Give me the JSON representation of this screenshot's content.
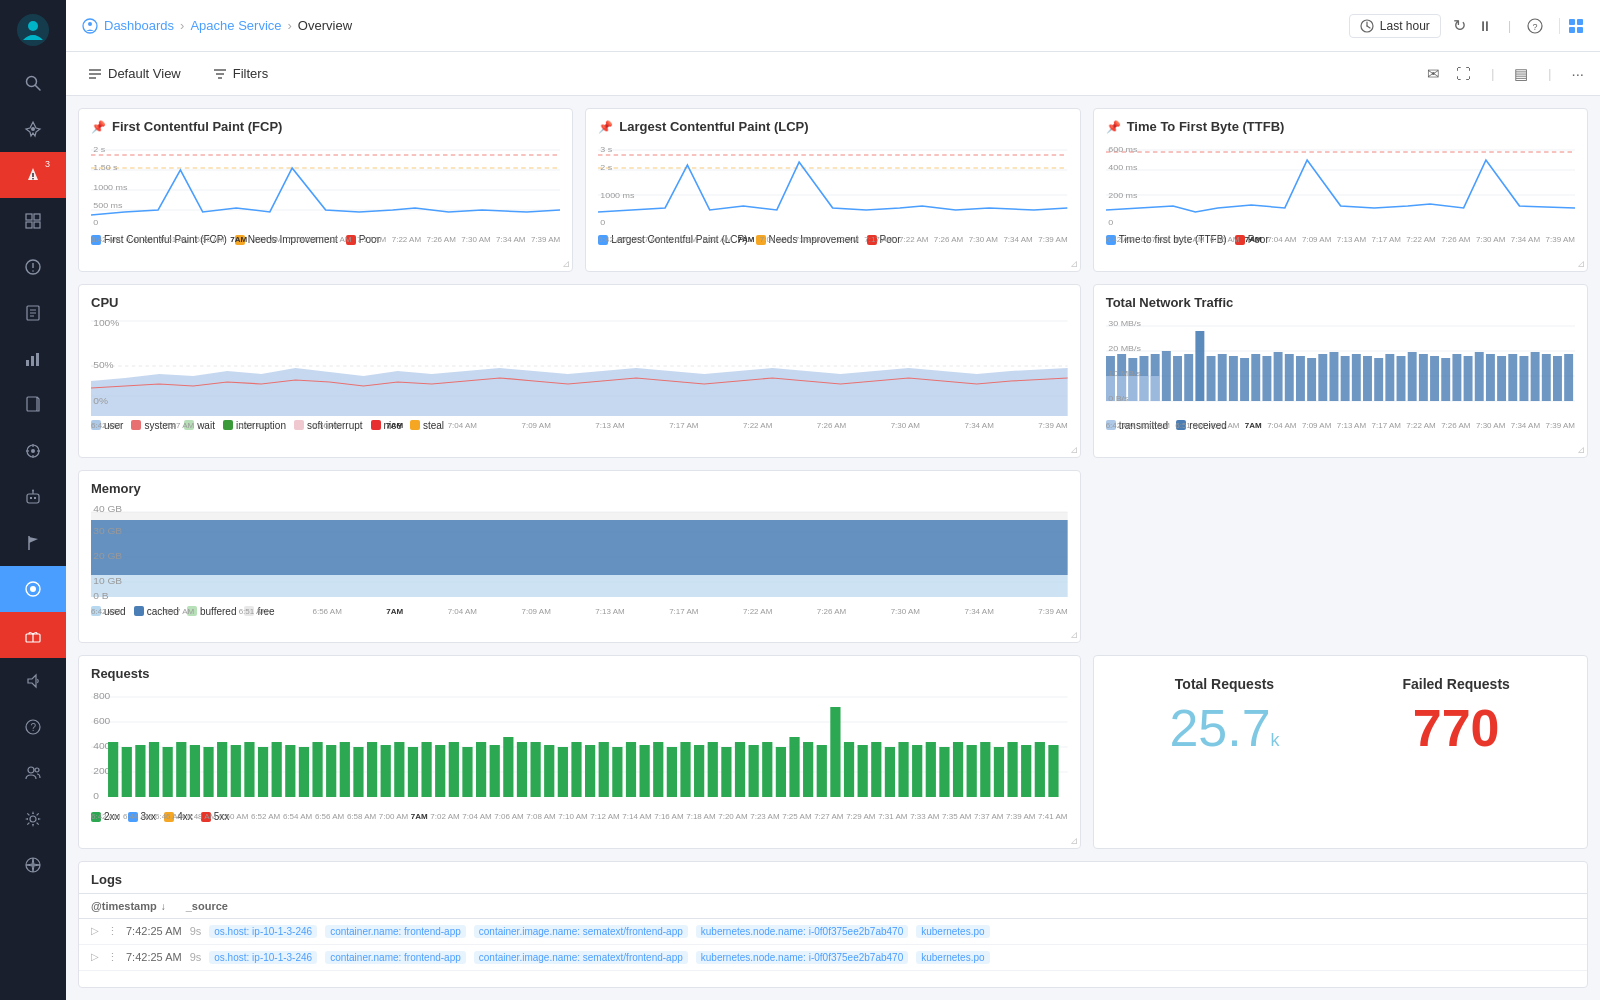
{
  "sidebar": {
    "items": [
      {
        "name": "logo",
        "icon": "🐙"
      },
      {
        "name": "search",
        "icon": "🔍"
      },
      {
        "name": "rocket",
        "icon": "🚀"
      },
      {
        "name": "alerts",
        "icon": "🔔",
        "badge": "3"
      },
      {
        "name": "grid",
        "icon": "⊞"
      },
      {
        "name": "warning",
        "icon": "⚠"
      },
      {
        "name": "reports",
        "icon": "📊"
      },
      {
        "name": "bar-chart",
        "icon": "📈"
      },
      {
        "name": "docs",
        "icon": "📄"
      },
      {
        "name": "crosshair",
        "icon": "⊕"
      },
      {
        "name": "robot",
        "icon": "🤖"
      },
      {
        "name": "flag",
        "icon": "⚑"
      },
      {
        "name": "active-icon",
        "icon": "◉"
      },
      {
        "name": "gift",
        "icon": "🎁"
      },
      {
        "name": "speaker",
        "icon": "📣"
      },
      {
        "name": "help",
        "icon": "?"
      },
      {
        "name": "users",
        "icon": "👥"
      },
      {
        "name": "settings",
        "icon": "⚙"
      },
      {
        "name": "globe",
        "icon": "🌐"
      }
    ]
  },
  "topnav": {
    "breadcrumb": {
      "dashboards": "Dashboards",
      "service": "Apache Service",
      "current": "Overview"
    },
    "time_label": "Last hour",
    "refresh_icon": "↻",
    "pause_icon": "⏸",
    "help_icon": "?"
  },
  "toolbar": {
    "default_view_label": "Default View",
    "filters_label": "Filters",
    "email_icon": "✉",
    "fullscreen_icon": "⛶",
    "columns_icon": "▤",
    "more_icon": "···"
  },
  "panels": {
    "fcp": {
      "title": "First Contentful Paint (FCP)",
      "legend": [
        {
          "label": "First Contentful Paint (FCP)",
          "color": "#4a9eff"
        },
        {
          "label": "Needs Improvement",
          "color": "#f5a623"
        },
        {
          "label": "Poor",
          "color": "#e8362a"
        }
      ],
      "y_labels": [
        "2 s",
        "1.50 s",
        "1000 ms",
        "500 ms",
        "0"
      ]
    },
    "lcp": {
      "title": "Largest Contentful Paint (LCP)",
      "legend": [
        {
          "label": "Largest Contentful Paint (LCP)",
          "color": "#4a9eff"
        },
        {
          "label": "Needs Improvement",
          "color": "#f5a623"
        },
        {
          "label": "Poor",
          "color": "#e8362a"
        }
      ],
      "y_labels": [
        "3 s",
        "2 s",
        "1000 ms",
        "0"
      ]
    },
    "ttfb": {
      "title": "Time To First Byte (TTFB)",
      "legend": [
        {
          "label": "Time to first byte (TTFB)",
          "color": "#4a9eff"
        },
        {
          "label": "Poor",
          "color": "#e8362a"
        }
      ],
      "y_labels": [
        "600 ms",
        "400 ms",
        "200 ms",
        "0"
      ]
    },
    "cpu": {
      "title": "CPU",
      "legend": [
        {
          "label": "user",
          "color": "#aec8e8"
        },
        {
          "label": "system",
          "color": "#e87070"
        },
        {
          "label": "wait",
          "color": "#b8e0b8"
        },
        {
          "label": "interruption",
          "color": "#3a9a3a"
        },
        {
          "label": "soft interrupt",
          "color": "#f0c8d0"
        },
        {
          "label": "nice",
          "color": "#e83030"
        },
        {
          "label": "steal",
          "color": "#f5a623"
        }
      ],
      "y_labels": [
        "100%",
        "50%",
        "0%"
      ]
    },
    "memory": {
      "title": "Memory",
      "legend": [
        {
          "label": "used",
          "color": "#b8d8f0"
        },
        {
          "label": "cached",
          "color": "#4a7eb5"
        },
        {
          "label": "buffered",
          "color": "#b8e0b8"
        },
        {
          "label": "free",
          "color": "#e0e0e0"
        }
      ],
      "y_labels": [
        "40 GB",
        "30 GB",
        "20 GB",
        "10 GB",
        "0 B"
      ]
    },
    "network": {
      "title": "Total Network Traffic",
      "legend": [
        {
          "label": "transmitted",
          "color": "#aec8e8"
        },
        {
          "label": "received",
          "color": "#4a7eb5"
        }
      ],
      "y_labels": [
        "30 MB/s",
        "20 MB/s",
        "10 MB/s",
        "0 B/s"
      ]
    },
    "requests": {
      "title": "Requests",
      "legend": [
        {
          "label": "2xx",
          "color": "#2da852"
        },
        {
          "label": "3xx",
          "color": "#4a9eff"
        },
        {
          "label": "4xx",
          "color": "#f5a623"
        },
        {
          "label": "5xx",
          "color": "#e8362a"
        }
      ],
      "y_labels": [
        "800",
        "600",
        "400",
        "200",
        "0"
      ]
    },
    "total_requests": {
      "title": "Total Requests",
      "value": "25.7",
      "suffix": "k"
    },
    "failed_requests": {
      "title": "Failed Requests",
      "value": "770"
    }
  },
  "logs": {
    "title": "Logs",
    "headers": [
      "@timestamp",
      "_source"
    ],
    "rows": [
      {
        "time": "7:42:25 AM",
        "age": "9s",
        "os_host": "ip-10-1-3-246",
        "container_name": "frontend-app",
        "container_image": "sematext/frontend-app",
        "node_name": "i-0f0f375ee2b7ab470",
        "k8s": "kubernetes.po"
      },
      {
        "time": "7:42:25 AM",
        "age": "9s",
        "os_host": "ip-10-1-3-246",
        "container_name": "frontend-app",
        "container_image": "sematext/frontend-app",
        "node_name": "i-0f0f375ee2b7ab470",
        "k8s": "kubernetes.po"
      }
    ]
  },
  "x_labels": [
    "6:42 AM",
    "6:47 AM",
    "6:51 AM",
    "6:56 AM",
    "7AM",
    "7:04 AM",
    "7:09 AM",
    "7:13 AM",
    "7:17 AM",
    "7:22 AM",
    "7:26 AM",
    "7:30 AM",
    "7:34 AM",
    "7:39 AM"
  ]
}
